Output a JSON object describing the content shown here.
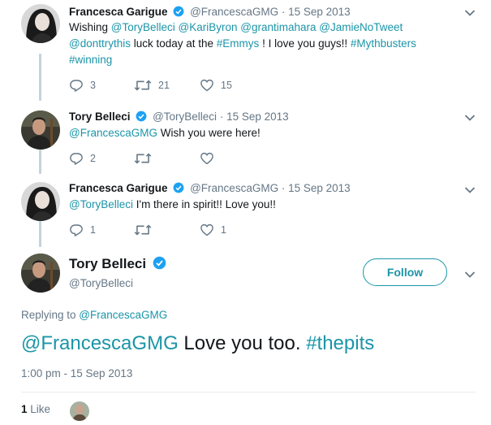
{
  "colors": {
    "link": "#1b95a8",
    "muted": "#657786",
    "verified": "#1da1f2",
    "thread_line": "#c4d3dd"
  },
  "tweets": [
    {
      "name": "Francesca Garigue",
      "handle": "@FrancescaGMG",
      "sep": "·",
      "date": "15 Sep 2013",
      "text_parts": [
        "Wishing ",
        "@ToryBelleci",
        " ",
        "@KariByron",
        " ",
        "@grantimahara",
        " ",
        "@JamieNoTweet",
        "@donttrythis",
        " luck today at the ",
        "#Emmys",
        " ! I love you guys!! ",
        "#Mythbusters",
        "#winning"
      ],
      "replies": "3",
      "retweets": "21",
      "likes": "15"
    },
    {
      "name": "Tory Belleci",
      "handle": "@ToryBelleci",
      "sep": "·",
      "date": "15 Sep 2013",
      "text_parts": [
        "@FrancescaGMG",
        " Wish you were here!"
      ],
      "replies": "2",
      "retweets": "",
      "likes": ""
    },
    {
      "name": "Francesca Garigue",
      "handle": "@FrancescaGMG",
      "sep": "·",
      "date": "15 Sep 2013",
      "text_parts": [
        "@ToryBelleci",
        " I'm there in spirit!! Love you!!"
      ],
      "replies": "1",
      "retweets": "",
      "likes": "1"
    }
  ],
  "main_tweet": {
    "name": "Tory Belleci",
    "handle": "@ToryBelleci",
    "follow_label": "Follow",
    "replying_prefix": "Replying to ",
    "replying_to": "@FrancescaGMG",
    "text_mention": "@FrancescaGMG",
    "text_body": " Love you too. ",
    "text_hashtag": "#thepits",
    "timestamp": "1:00 pm - 15 Sep 2013",
    "like_count": "1",
    "like_label": " Like"
  },
  "icons": [
    "verified-icon",
    "chevron-down-icon",
    "reply-icon",
    "retweet-icon",
    "heart-icon"
  ]
}
